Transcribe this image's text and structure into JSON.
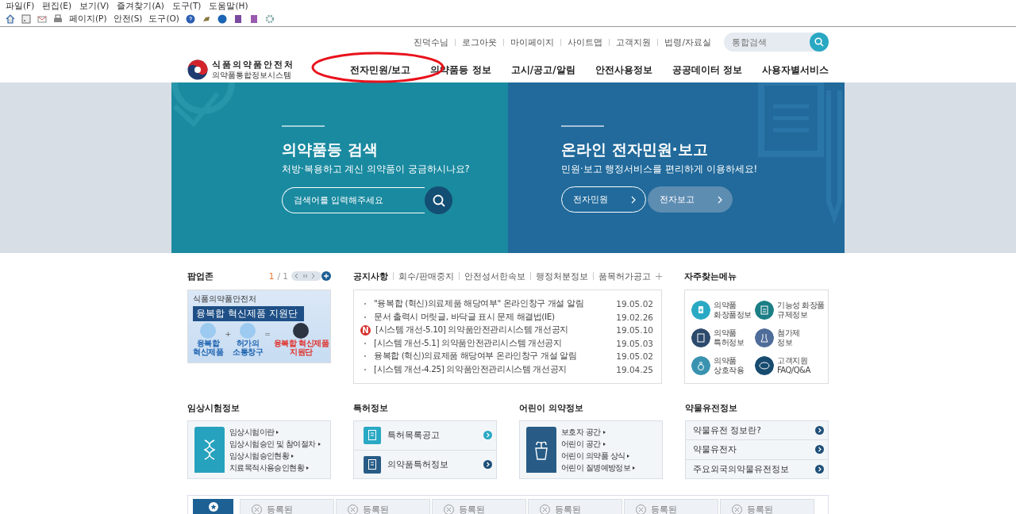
{
  "browser": {
    "menu": [
      "파일(F)",
      "편집(E)",
      "보기(V)",
      "즐겨찾기(A)",
      "도구(T)",
      "도움말(H)"
    ],
    "toolbar": [
      "페이지(P)",
      "안전(S)",
      "도구(O)"
    ]
  },
  "header": {
    "logo": {
      "title": "식품의약품안전처",
      "subtitle": "의약품통합정보시스템"
    },
    "util_links": [
      "진덕수님",
      "로그아웃",
      "마이페이지",
      "사이트맵",
      "고객지원",
      "법령/자료실"
    ],
    "search": {
      "placeholder": "통합검색"
    },
    "nav": [
      {
        "label": "전자민원/보고",
        "selected": false
      },
      {
        "label": "의약품등 정보",
        "selected": false
      },
      {
        "label": "고시/공고/알림",
        "selected": false
      },
      {
        "label": "안전사용정보",
        "selected": false
      },
      {
        "label": "공공데이터 정보",
        "selected": false
      },
      {
        "label": "사용자별서비스",
        "selected": false
      }
    ]
  },
  "annotations": [
    {
      "kind": "ellipse"
    }
  ],
  "hero": [
    {
      "kind": "search",
      "title": "의약품등 검색",
      "subtitle": "처방·복용하고 계신 의약품이 궁금하시나요?",
      "placeholder": "검색어를 입력해주세요"
    },
    {
      "kind": "buttons",
      "title": "온라인 전자민원·보고",
      "subtitle": "민원·보고 행정서비스를 편리하게 이용하세요!",
      "buttons": [
        {
          "label": "전자민원",
          "selected": false
        },
        {
          "label": "전자보고",
          "selected": true
        }
      ]
    }
  ],
  "popup": {
    "title": "팝업존",
    "page_current": "1",
    "page_total": "/ 1",
    "banner": {
      "org": "식품의약품안전처",
      "headline": "융복합 혁신제품 지원단",
      "steps": [
        "융복합\n혁신제품",
        "허가의\n소통창구",
        "융복합 혁신제품\n지원단"
      ],
      "operators": [
        "+",
        "="
      ]
    }
  },
  "notices": {
    "tabs": [
      {
        "label": "공지사항",
        "selected": true
      },
      {
        "label": "회수/판매중지",
        "selected": false
      },
      {
        "label": "안전성서한속보",
        "selected": false
      },
      {
        "label": "행정처분정보",
        "selected": false
      },
      {
        "label": "품목허가공고",
        "selected": false
      }
    ],
    "items": [
      {
        "title": "\"융복합 (혁신)의료제품 해당여부\" 온라인창구 개설 알림",
        "date": "19.05.02"
      },
      {
        "title": "문서 출력시 머릿글, 바닥글 표시 문제 해결법(IE)",
        "date": "19.02.26"
      },
      {
        "title": "[시스템 개선-5.10] 의약품안전관리시스템 개선공지",
        "date": "19.05.10",
        "badge": "N"
      },
      {
        "title": "[시스템 개선-5.1] 의약품안전관리시스템 개선공지",
        "date": "19.05.03"
      },
      {
        "title": "융복합 (혁신)의료제품 해당여부 온라인창구 개설 알림",
        "date": "19.05.02"
      },
      {
        "title": "[시스템 개선-4.25] 의약품안전관리시스템 개선공지",
        "date": "19.04.25"
      }
    ]
  },
  "quick_menu": {
    "title": "자주찾는메뉴",
    "items": [
      {
        "label": "의약품\n화장품정보",
        "color": "#2aa9c4"
      },
      {
        "label": "기능성 화장품\n규제정보",
        "color": "#1c7f86"
      },
      {
        "label": "의약품\n특허정보",
        "color": "#2c4a6b"
      },
      {
        "label": "첨가제\n정보",
        "color": "#4f6d9a"
      },
      {
        "label": "의약품\n상호작용",
        "color": "#3993b0"
      },
      {
        "label": "고객지원\nFAQ/Q&A",
        "color": "#174c70"
      }
    ]
  },
  "sections": [
    {
      "kind": "card",
      "title": "임상시험정보",
      "links": [
        "임상시험이란",
        "임상시험승인 및 참여절차",
        "임상시험승인현황",
        "치료목적사용승인현황"
      ]
    },
    {
      "kind": "icon_rows",
      "title": "특허정보",
      "rows": [
        {
          "label": "특허목록공고"
        },
        {
          "label": "의약품특허정보"
        }
      ]
    },
    {
      "kind": "card",
      "title": "어린이 의약정보",
      "links": [
        "보호자 공간",
        "어린이 공간",
        "어린이 의약품 상식",
        "어린이 질병예방정보"
      ]
    },
    {
      "kind": "rows",
      "title": "약물유전정보",
      "rows": [
        {
          "label": "약물유전 정보란?"
        },
        {
          "label": "약물유전자"
        },
        {
          "label": "주요외국의약물유전정보"
        }
      ]
    }
  ],
  "registered": {
    "tiles": [
      "등록된",
      "등록된",
      "등록된",
      "등록된",
      "등록된",
      "등록된"
    ]
  }
}
